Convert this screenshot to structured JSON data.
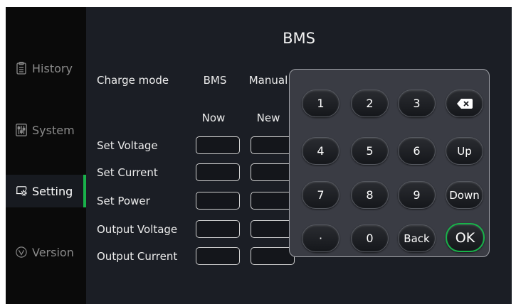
{
  "sidebar": {
    "items": [
      {
        "label": "History",
        "icon": "clipboard-icon",
        "active": false
      },
      {
        "label": "System",
        "icon": "sliders-icon",
        "active": false
      },
      {
        "label": "Setting",
        "icon": "gear-screen-icon",
        "active": true
      },
      {
        "label": "Version",
        "icon": "check-circle-icon",
        "active": false
      }
    ]
  },
  "main": {
    "title": "BMS",
    "charge_mode_label": "Charge mode",
    "mode_bms": "BMS",
    "mode_manual": "Manual",
    "col_now": "Now",
    "col_new": "New",
    "rows": [
      {
        "label": "Set Voltage"
      },
      {
        "label": "Set Current"
      },
      {
        "label": "Set Power"
      },
      {
        "label": "Output Voltage"
      },
      {
        "label": "Output Current"
      }
    ]
  },
  "keypad": {
    "keys": [
      "1",
      "2",
      "3",
      "backspace",
      "4",
      "5",
      "6",
      "Up",
      "7",
      "8",
      "9",
      "Down",
      "·",
      "0",
      "Back",
      "OK"
    ]
  },
  "colors": {
    "accent": "#19b14a",
    "background": "#1b1e25",
    "keypad_bg": "#3a3c44"
  }
}
